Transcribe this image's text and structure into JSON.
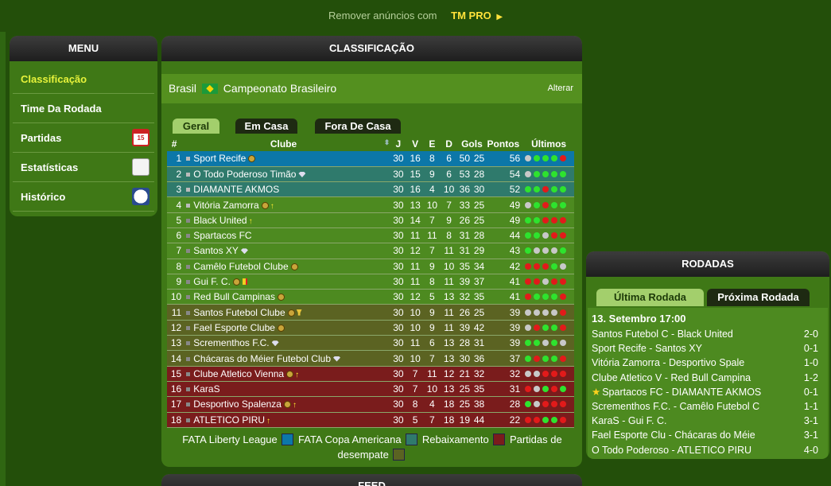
{
  "promo": {
    "text": "Remover anúncios com",
    "link": "TM PRO"
  },
  "menu": {
    "title": "MENU",
    "items": [
      {
        "label": "Classificação",
        "icon": "",
        "active": true
      },
      {
        "label": "Time Da Rodada",
        "icon": ""
      },
      {
        "label": "Partidas",
        "icon": "calendar-icon",
        "icon_text": "15"
      },
      {
        "label": "Estatísticas",
        "icon": "chart-icon"
      },
      {
        "label": "Histórico",
        "icon": "history-clock-icon"
      }
    ]
  },
  "standings": {
    "title": "CLASSIFICAÇÃO",
    "country": "Brasil",
    "league": "Campeonato Brasileiro",
    "change_link": "Alterar",
    "tabs": [
      "Geral",
      "Em Casa",
      "Fora De Casa"
    ],
    "active_tab": "Geral",
    "headers": [
      "#",
      "Clube",
      "J",
      "V",
      "E",
      "D",
      "Gols",
      "Pontos",
      "Últimos"
    ],
    "rows": [
      {
        "pos": "1",
        "club": "Sport Recife",
        "badges": [
          "medal"
        ],
        "zone": "liberty",
        "j": "30",
        "v": "16",
        "e": "8",
        "d": "6",
        "gp": "50",
        "ga": "25",
        "pts": "56",
        "last": [
          "d",
          "w",
          "w",
          "w",
          "l"
        ]
      },
      {
        "pos": "2",
        "club": "O Todo Poderoso Timão",
        "badges": [
          "diamond"
        ],
        "zone": "copa",
        "j": "30",
        "v": "15",
        "e": "9",
        "d": "6",
        "gp": "53",
        "ga": "28",
        "pts": "54",
        "last": [
          "d",
          "w",
          "w",
          "w",
          "w"
        ]
      },
      {
        "pos": "3",
        "club": "DIAMANTE AKMOS",
        "badges": [],
        "zone": "copa",
        "j": "30",
        "v": "16",
        "e": "4",
        "d": "10",
        "gp": "36",
        "ga": "30",
        "pts": "52",
        "last": [
          "w",
          "w",
          "l",
          "w",
          "w"
        ]
      },
      {
        "pos": "4",
        "club": "Vitória Zamorra",
        "badges": [
          "medal",
          "up"
        ],
        "zone": "none",
        "j": "30",
        "v": "13",
        "e": "10",
        "d": "7",
        "gp": "33",
        "ga": "25",
        "pts": "49",
        "last": [
          "d",
          "w",
          "l",
          "w",
          "w"
        ]
      },
      {
        "pos": "5",
        "club": "Black United",
        "badges": [
          "up"
        ],
        "zone": "none",
        "j": "30",
        "v": "14",
        "e": "7",
        "d": "9",
        "gp": "26",
        "ga": "25",
        "pts": "49",
        "last": [
          "w",
          "w",
          "l",
          "l",
          "l"
        ]
      },
      {
        "pos": "6",
        "club": "Spartacos FC",
        "badges": [],
        "zone": "none",
        "j": "30",
        "v": "11",
        "e": "11",
        "d": "8",
        "gp": "31",
        "ga": "28",
        "pts": "44",
        "last": [
          "w",
          "w",
          "d",
          "l",
          "l"
        ]
      },
      {
        "pos": "7",
        "club": "Santos XY",
        "badges": [
          "diamond"
        ],
        "zone": "none",
        "j": "30",
        "v": "12",
        "e": "7",
        "d": "11",
        "gp": "31",
        "ga": "29",
        "pts": "43",
        "last": [
          "w",
          "d",
          "d",
          "d",
          "w"
        ]
      },
      {
        "pos": "8",
        "club": "Camêlo Futebol Clube",
        "badges": [
          "medal"
        ],
        "zone": "none",
        "j": "30",
        "v": "11",
        "e": "9",
        "d": "10",
        "gp": "35",
        "ga": "34",
        "pts": "42",
        "last": [
          "l",
          "l",
          "l",
          "w",
          "d"
        ]
      },
      {
        "pos": "9",
        "club": "Gui F. C.",
        "badges": [
          "medal",
          "card"
        ],
        "zone": "none",
        "j": "30",
        "v": "11",
        "e": "8",
        "d": "11",
        "gp": "39",
        "ga": "37",
        "pts": "41",
        "last": [
          "l",
          "l",
          "d",
          "l",
          "l"
        ]
      },
      {
        "pos": "10",
        "club": "Red Bull Campinas",
        "badges": [
          "medal"
        ],
        "zone": "none",
        "j": "30",
        "v": "12",
        "e": "5",
        "d": "13",
        "gp": "32",
        "ga": "35",
        "pts": "41",
        "last": [
          "l",
          "w",
          "w",
          "w",
          "l"
        ]
      },
      {
        "pos": "11",
        "club": "Santos Futebol Clube",
        "badges": [
          "medal",
          "trophy"
        ],
        "zone": "playoff",
        "j": "30",
        "v": "10",
        "e": "9",
        "d": "11",
        "gp": "26",
        "ga": "25",
        "pts": "39",
        "last": [
          "d",
          "d",
          "d",
          "d",
          "l"
        ]
      },
      {
        "pos": "12",
        "club": "Fael Esporte Clube",
        "badges": [
          "medal"
        ],
        "zone": "playoff",
        "j": "30",
        "v": "10",
        "e": "9",
        "d": "11",
        "gp": "39",
        "ga": "42",
        "pts": "39",
        "last": [
          "d",
          "l",
          "w",
          "w",
          "l"
        ]
      },
      {
        "pos": "13",
        "club": "Scrementhos F.C.",
        "badges": [
          "diamond"
        ],
        "zone": "playoff",
        "j": "30",
        "v": "11",
        "e": "6",
        "d": "13",
        "gp": "28",
        "ga": "31",
        "pts": "39",
        "last": [
          "w",
          "w",
          "d",
          "w",
          "d"
        ]
      },
      {
        "pos": "14",
        "club": "Chácaras do Méier Futebol Club",
        "badges": [
          "diamond"
        ],
        "zone": "playoff",
        "j": "30",
        "v": "10",
        "e": "7",
        "d": "13",
        "gp": "30",
        "ga": "36",
        "pts": "37",
        "last": [
          "w",
          "l",
          "w",
          "w",
          "l"
        ]
      },
      {
        "pos": "15",
        "club": "Clube Atletico Vienna",
        "badges": [
          "medal",
          "up"
        ],
        "zone": "rebaix",
        "j": "30",
        "v": "7",
        "e": "11",
        "d": "12",
        "gp": "21",
        "ga": "32",
        "pts": "32",
        "last": [
          "d",
          "d",
          "l",
          "l",
          "l"
        ]
      },
      {
        "pos": "16",
        "club": "KaraS",
        "badges": [],
        "zone": "rebaix",
        "j": "30",
        "v": "7",
        "e": "10",
        "d": "13",
        "gp": "25",
        "ga": "35",
        "pts": "31",
        "last": [
          "l",
          "d",
          "w",
          "l",
          "w"
        ]
      },
      {
        "pos": "17",
        "club": "Desportivo Spalenza",
        "badges": [
          "medal",
          "up"
        ],
        "zone": "rebaix",
        "j": "30",
        "v": "8",
        "e": "4",
        "d": "18",
        "gp": "25",
        "ga": "38",
        "pts": "28",
        "last": [
          "w",
          "d",
          "l",
          "l",
          "l"
        ]
      },
      {
        "pos": "18",
        "club": "ATLETICO PIRU",
        "badges": [
          "up"
        ],
        "zone": "rebaix",
        "j": "30",
        "v": "5",
        "e": "7",
        "d": "18",
        "gp": "19",
        "ga": "44",
        "pts": "22",
        "last": [
          "l",
          "l",
          "w",
          "w",
          "l"
        ]
      }
    ],
    "legend": [
      {
        "label": "FATA Liberty League",
        "color": "#0c77a8"
      },
      {
        "label": "FATA Copa Americana",
        "color": "#2f7a6c"
      },
      {
        "label": "Rebaixamento",
        "color": "#7a1c1c"
      },
      {
        "label": "Partidas de desempate",
        "color": "#5b6322"
      }
    ]
  },
  "rounds": {
    "title": "RODADAS",
    "tabs": [
      "Última Rodada",
      "Próxima Rodada"
    ],
    "date": "13. Setembro 17:00",
    "matches": [
      {
        "teams": "Santos Futebol C - Black United",
        "score": "2-0",
        "star": false
      },
      {
        "teams": "Sport Recife - Santos XY",
        "score": "0-1",
        "star": false
      },
      {
        "teams": "Vitória Zamorra - Desportivo Spale",
        "score": "1-0",
        "star": false
      },
      {
        "teams": "Clube Atletico V - Red Bull Campina",
        "score": "1-2",
        "star": false
      },
      {
        "teams": "Spartacos FC - DIAMANTE AKMOS",
        "score": "0-1",
        "star": true
      },
      {
        "teams": "Scrementhos F.C. - Camêlo Futebol C",
        "score": "1-1",
        "star": false
      },
      {
        "teams": "KaraS - Gui F. C.",
        "score": "3-1",
        "star": false
      },
      {
        "teams": "Fael Esporte Clu - Chácaras do Méie",
        "score": "3-1",
        "star": false
      },
      {
        "teams": "O Todo Poderoso - ATLETICO PIRU",
        "score": "4-0",
        "star": false
      }
    ]
  },
  "feed": {
    "title": "FEED"
  },
  "colors": {
    "win": "#2ee32e",
    "draw": "#c8c8c8",
    "loss": "#e21a1a",
    "accent": "#e7f33b"
  }
}
